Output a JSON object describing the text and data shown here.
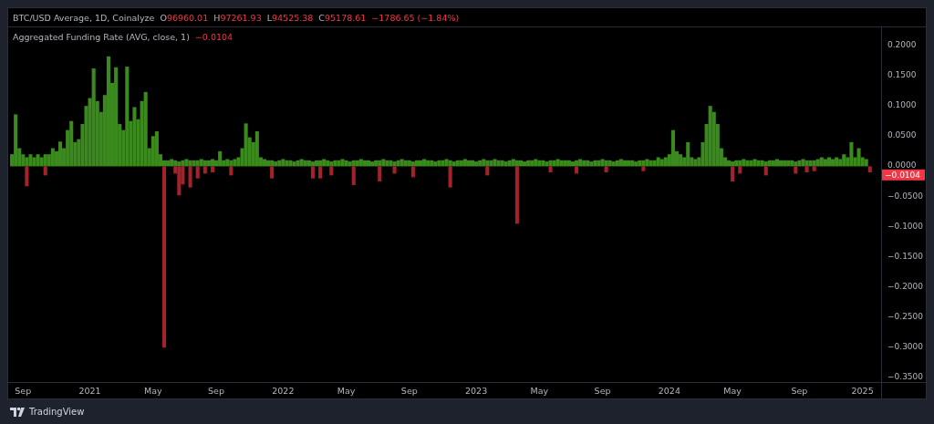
{
  "legend": {
    "symbol": "BTC/USD Average, 1D, Coinalyze",
    "ohlc": [
      {
        "label": "O",
        "value": "96960.01"
      },
      {
        "label": "H",
        "value": "97261.93"
      },
      {
        "label": "L",
        "value": "94525.38"
      },
      {
        "label": "C",
        "value": "95178.61"
      }
    ],
    "change": "−1786.65 (−1.84%)"
  },
  "indicator": {
    "title": "Aggregated Funding Rate (AVG, close, 1)",
    "value": "−0.0104"
  },
  "price_tag": {
    "label": "−0.0104"
  },
  "chart_data": {
    "type": "bar",
    "ylim": [
      -0.357,
      0.23
    ],
    "categories": [
      null,
      null,
      null,
      "Sep",
      null,
      null,
      null,
      null,
      null,
      null,
      null,
      null,
      null,
      null,
      null,
      null,
      null,
      null,
      null,
      null,
      null,
      "2021",
      null,
      null,
      null,
      null,
      null,
      null,
      null,
      null,
      null,
      null,
      null,
      null,
      null,
      null,
      null,
      null,
      "May",
      null,
      null,
      null,
      null,
      null,
      null,
      null,
      null,
      null,
      null,
      null,
      null,
      null,
      null,
      null,
      null,
      "Sep",
      null,
      null,
      null,
      null,
      null,
      null,
      null,
      null,
      null,
      null,
      null,
      null,
      null,
      null,
      null,
      null,
      null,
      "2022",
      null,
      null,
      null,
      null,
      null,
      null,
      null,
      null,
      null,
      null,
      null,
      null,
      null,
      null,
      null,
      null,
      "May",
      null,
      null,
      null,
      null,
      null,
      null,
      null,
      null,
      null,
      null,
      null,
      null,
      null,
      null,
      null,
      null,
      "Sep",
      null,
      null,
      null,
      null,
      null,
      null,
      null,
      null,
      null,
      null,
      null,
      null,
      null,
      null,
      null,
      null,
      null,
      "2023",
      null,
      null,
      null,
      null,
      null,
      null,
      null,
      null,
      null,
      null,
      null,
      null,
      null,
      null,
      null,
      null,
      "May",
      null,
      null,
      null,
      null,
      null,
      null,
      null,
      null,
      null,
      null,
      null,
      null,
      null,
      null,
      null,
      null,
      "Sep",
      null,
      null,
      null,
      null,
      null,
      null,
      null,
      null,
      null,
      null,
      null,
      null,
      null,
      null,
      null,
      null,
      null,
      "2024",
      null,
      null,
      null,
      null,
      null,
      null,
      null,
      null,
      null,
      null,
      null,
      null,
      null,
      null,
      null,
      null,
      "May",
      null,
      null,
      null,
      null,
      null,
      null,
      null,
      null,
      null,
      null,
      null,
      null,
      null,
      null,
      null,
      null,
      null,
      "Sep",
      null,
      null,
      null,
      null,
      null,
      null,
      null,
      null,
      null,
      null,
      null,
      null,
      null,
      null,
      null,
      null,
      "2025",
      null,
      null
    ],
    "yticks": [
      {
        "value": 0.2,
        "label": "0.2000"
      },
      {
        "value": 0.15,
        "label": "0.1500"
      },
      {
        "value": 0.1,
        "label": "0.1000"
      },
      {
        "value": 0.05,
        "label": "0.0500"
      },
      {
        "value": 0,
        "label": "0.0000"
      },
      {
        "value": -0.05,
        "label": "−0.0500"
      },
      {
        "value": -0.1,
        "label": "−0.1000"
      },
      {
        "value": -0.15,
        "label": "−0.1500"
      },
      {
        "value": -0.2,
        "label": "−0.2000"
      },
      {
        "value": -0.25,
        "label": "−0.2500"
      },
      {
        "value": -0.3,
        "label": "−0.3000"
      },
      {
        "value": -0.35,
        "label": "−0.3500"
      }
    ],
    "series": [
      {
        "color": "#3b8a1e",
        "values": [
          0.02,
          0.086,
          0.03,
          0.02,
          0.015,
          0.02,
          0.015,
          0.02,
          0.015,
          0.02,
          0.02,
          0.03,
          0.025,
          0.041,
          0.03,
          0.06,
          0.075,
          0.04,
          0.045,
          0.07,
          0.1,
          0.113,
          0.162,
          0.108,
          0.09,
          0.118,
          0.182,
          0.138,
          0.164,
          0.07,
          0.06,
          0.165,
          0.075,
          0.098,
          0.078,
          0.108,
          0.123,
          0.03,
          0.05,
          0.058,
          0.02,
          0.01,
          0.01,
          0.012,
          0.01,
          0.008,
          0.01,
          0.012,
          0.01,
          0.01,
          0.01,
          0.012,
          0.01,
          0.01,
          0.012,
          0.01,
          0.025,
          0.01,
          0.012,
          0.01,
          0.012,
          0.015,
          0.03,
          0.071,
          0.048,
          0.04,
          0.058,
          0.015,
          0.012,
          0.01,
          0.01,
          0.008,
          0.01,
          0.012,
          0.01,
          0.01,
          0.008,
          0.01,
          0.012,
          0.01,
          0.01,
          0.008,
          0.01,
          0.01,
          0.012,
          0.01,
          0.008,
          0.01,
          0.01,
          0.012,
          0.01,
          0.008,
          0.01,
          0.01,
          0.012,
          0.01,
          0.01,
          0.008,
          0.01,
          0.01,
          0.012,
          0.01,
          0.01,
          0.008,
          0.01,
          0.012,
          0.01,
          0.01,
          0.008,
          0.01,
          0.01,
          0.012,
          0.01,
          0.01,
          0.008,
          0.01,
          0.01,
          0.012,
          0.01,
          0.008,
          0.01,
          0.01,
          0.012,
          0.01,
          0.01,
          0.008,
          0.01,
          0.012,
          0.01,
          0.01,
          0.012,
          0.01,
          0.01,
          0.008,
          0.01,
          0.012,
          0.01,
          0.01,
          0.008,
          0.01,
          0.01,
          0.012,
          0.01,
          0.01,
          0.008,
          0.01,
          0.01,
          0.012,
          0.01,
          0.01,
          0.01,
          0.008,
          0.01,
          0.012,
          0.01,
          0.01,
          0.008,
          0.01,
          0.01,
          0.012,
          0.01,
          0.01,
          0.008,
          0.01,
          0.012,
          0.01,
          0.01,
          0.01,
          0.008,
          0.01,
          0.01,
          0.012,
          0.01,
          0.01,
          0.015,
          0.012,
          0.015,
          0.02,
          0.06,
          0.025,
          0.02,
          0.015,
          0.04,
          0.015,
          0.012,
          0.015,
          0.04,
          0.07,
          0.1,
          0.09,
          0.07,
          0.03,
          0.015,
          0.01,
          0.008,
          0.01,
          0.01,
          0.012,
          0.01,
          0.01,
          0.012,
          0.01,
          0.01,
          0.008,
          0.01,
          0.01,
          0.012,
          0.01,
          0.01,
          0.01,
          0.01,
          0.008,
          0.01,
          0.012,
          0.01,
          0.01,
          0.01,
          0.012,
          0.015,
          0.012,
          0.015,
          0.012,
          0.015,
          0.012,
          0.02,
          0.015,
          0.04,
          0.015,
          0.03,
          0.015,
          0.012,
          null
        ]
      },
      {
        "color": "#a3222b",
        "values": [
          null,
          null,
          null,
          null,
          -0.033,
          null,
          null,
          null,
          null,
          -0.015,
          null,
          null,
          null,
          null,
          null,
          null,
          null,
          null,
          null,
          null,
          null,
          null,
          null,
          null,
          null,
          null,
          null,
          null,
          null,
          null,
          null,
          null,
          null,
          null,
          null,
          null,
          null,
          null,
          null,
          null,
          null,
          -0.3,
          null,
          null,
          -0.012,
          -0.048,
          -0.03,
          null,
          -0.035,
          null,
          -0.02,
          null,
          -0.012,
          null,
          -0.01,
          null,
          null,
          null,
          null,
          -0.015,
          null,
          null,
          null,
          null,
          null,
          null,
          null,
          null,
          null,
          null,
          -0.02,
          null,
          null,
          null,
          null,
          null,
          null,
          null,
          null,
          null,
          null,
          -0.02,
          null,
          -0.02,
          null,
          null,
          -0.015,
          null,
          null,
          null,
          null,
          null,
          -0.031,
          null,
          null,
          null,
          null,
          null,
          null,
          -0.025,
          null,
          null,
          null,
          -0.012,
          null,
          null,
          null,
          null,
          -0.018,
          null,
          null,
          null,
          null,
          null,
          null,
          null,
          null,
          null,
          -0.035,
          null,
          null,
          null,
          null,
          null,
          null,
          null,
          null,
          null,
          -0.015,
          null,
          null,
          null,
          null,
          null,
          null,
          null,
          -0.095,
          null,
          null,
          null,
          null,
          null,
          null,
          null,
          null,
          -0.01,
          null,
          null,
          null,
          null,
          null,
          null,
          -0.012,
          null,
          null,
          null,
          null,
          null,
          null,
          null,
          -0.01,
          null,
          null,
          null,
          null,
          null,
          null,
          null,
          null,
          null,
          -0.008,
          null,
          null,
          null,
          null,
          null,
          null,
          null,
          null,
          null,
          null,
          null,
          null,
          null,
          null,
          null,
          null,
          null,
          null,
          null,
          null,
          null,
          null,
          null,
          -0.025,
          null,
          -0.012,
          null,
          null,
          null,
          null,
          null,
          null,
          -0.015,
          null,
          null,
          null,
          null,
          null,
          null,
          null,
          -0.012,
          null,
          null,
          -0.01,
          null,
          -0.008,
          null,
          null,
          null,
          null,
          null,
          null,
          null,
          null,
          null,
          null,
          null,
          null,
          null,
          null,
          -0.01
        ]
      }
    ]
  },
  "footer": {
    "brand": "TradingView"
  }
}
